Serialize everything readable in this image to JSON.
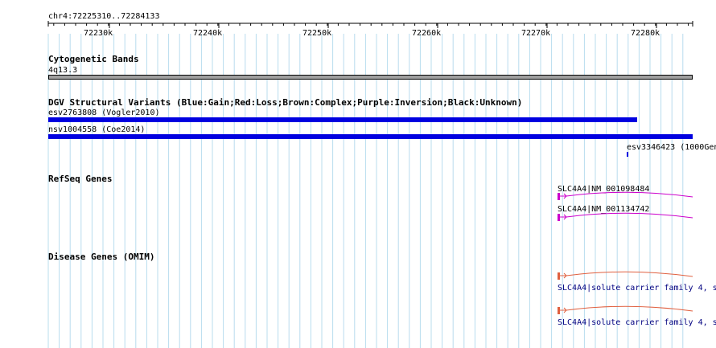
{
  "ruler": {
    "locus": "chr4:72225310..72284133",
    "ticks": [
      "72230k",
      "72240k",
      "72250k",
      "72260k",
      "72270k",
      "72280k"
    ]
  },
  "tracks": {
    "cytoband": {
      "title": "Cytogenetic Bands",
      "band_label": "4q13.3"
    },
    "dgv": {
      "title": "DGV Structural Variants (Blue:Gain;Red:Loss;Brown:Complex;Purple:Inversion;Black:Unknown)",
      "features": [
        {
          "id": "esv2763808",
          "study": "(Vogler2010)",
          "color": "#0000e0"
        },
        {
          "id": "nsv1004558",
          "study": "(Coe2014)",
          "color": "#0000e0"
        },
        {
          "label": "esv3346423 (1000Gen",
          "color": "#0000e0"
        }
      ]
    },
    "refseq": {
      "title": "RefSeq Genes",
      "features": [
        {
          "label": "SLC4A4|NM_001098484",
          "color": "#cc00cc"
        },
        {
          "label": "SLC4A4|NM_001134742",
          "color": "#cc00cc"
        }
      ]
    },
    "omim": {
      "title": "Disease Genes (OMIM)",
      "features": [
        {
          "label": "SLC4A4|solute carrier family 4, s",
          "color": "#e06040",
          "label_color": "#000080"
        },
        {
          "label": "SLC4A4|solute carrier family 4, s",
          "color": "#e06040",
          "label_color": "#000080"
        }
      ]
    }
  }
}
